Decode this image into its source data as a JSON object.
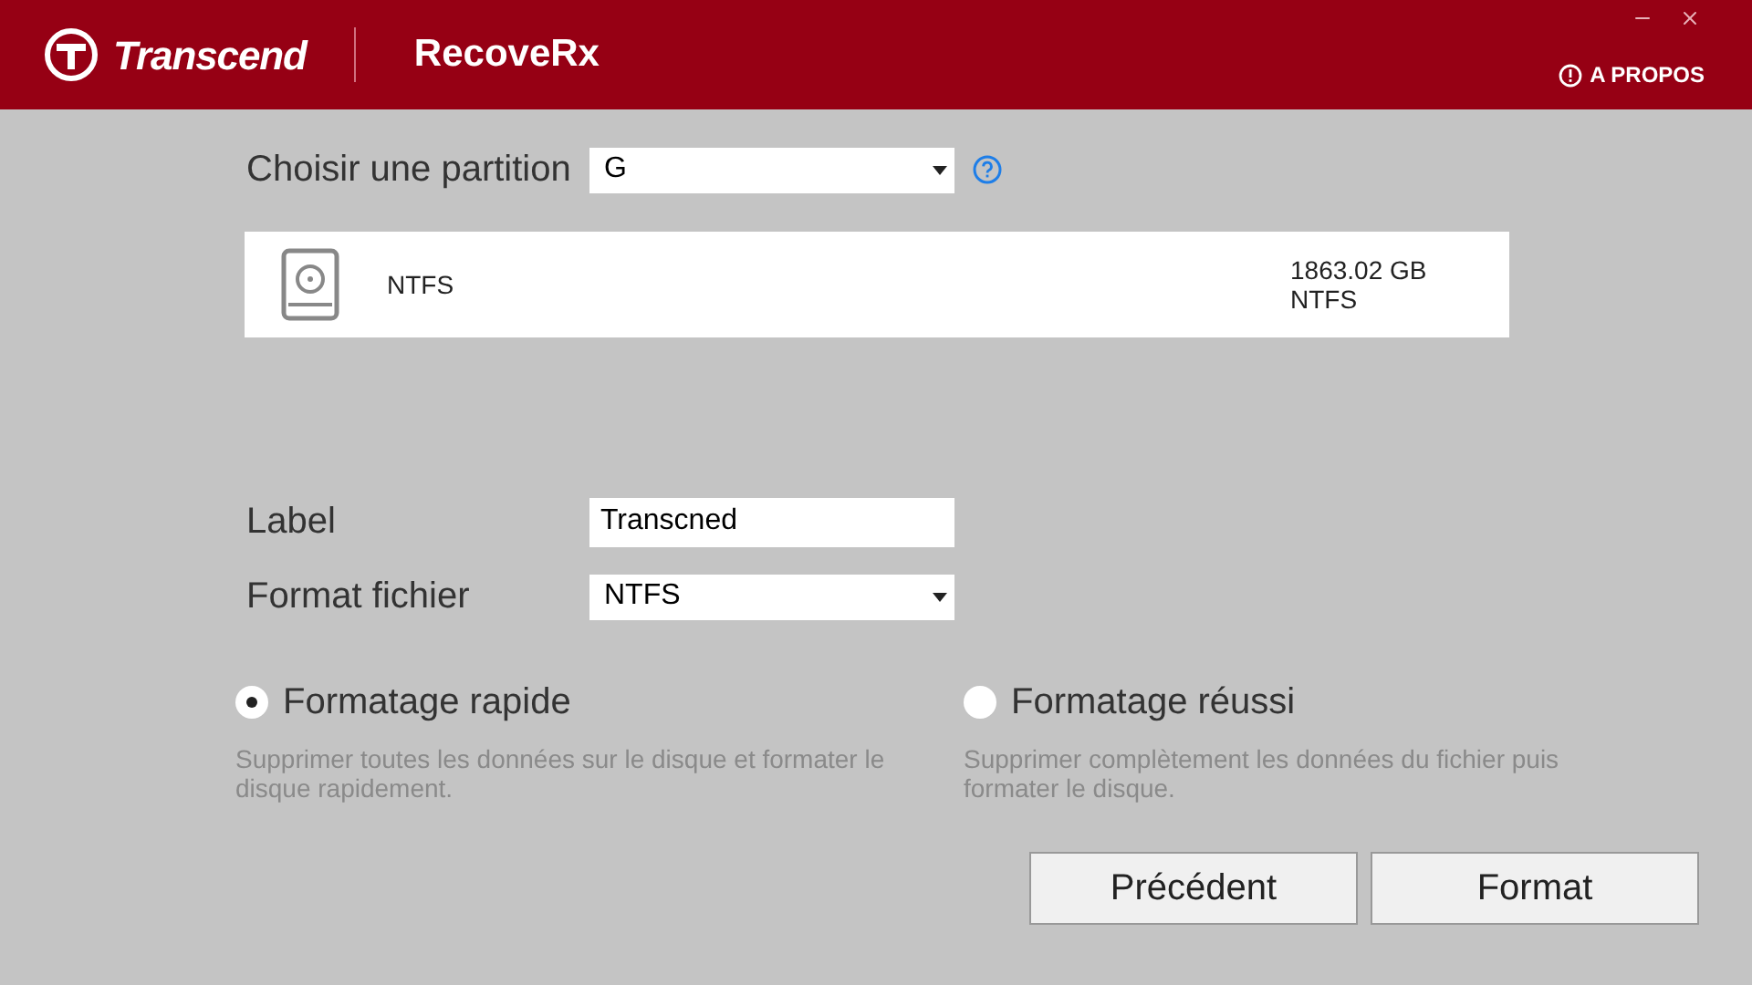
{
  "header": {
    "brand": "Transcend",
    "app_title": "RecoveRx",
    "about_link": "A PROPOS"
  },
  "partition": {
    "label": "Choisir une partition",
    "value": "G"
  },
  "partition_card": {
    "name": "NTFS",
    "size": "1863.02 GB",
    "filesystem": "NTFS"
  },
  "label_field": {
    "label": "Label",
    "value": "Transcned"
  },
  "format_field": {
    "label": "Format fichier",
    "value": "NTFS"
  },
  "format_options": [
    {
      "label": "Formatage rapide",
      "description": "Supprimer toutes les données sur le disque et formater le disque rapidement.",
      "selected": true
    },
    {
      "label": "Formatage réussi",
      "description": "Supprimer complètement les données du fichier puis formater le disque.",
      "selected": false
    }
  ],
  "buttons": [
    "Précédent",
    "Format"
  ]
}
